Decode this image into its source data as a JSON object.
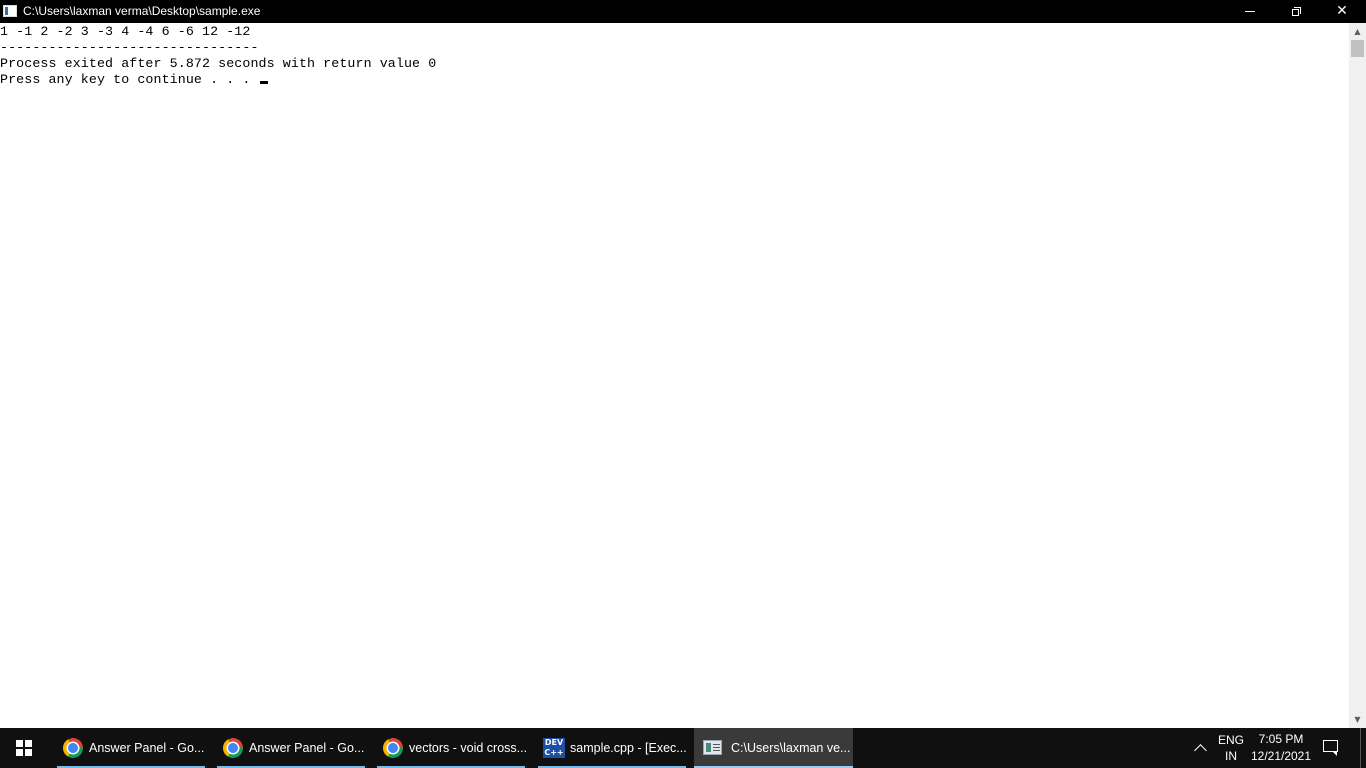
{
  "window": {
    "title": "C:\\Users\\laxman verma\\Desktop\\sample.exe",
    "controls": {
      "minimize": "minimize",
      "maximize": "restore",
      "close": "close"
    }
  },
  "console": {
    "lines": [
      "1 -1 2 -2 3 -3 4 -4 6 -6 12 -12",
      "--------------------------------",
      "Process exited after 5.872 seconds with return value 0",
      "Press any key to continue . . . "
    ]
  },
  "taskbar": {
    "items": [
      {
        "label": "Answer Panel - Go...",
        "icon": "chrome-icon",
        "active": false
      },
      {
        "label": "Answer Panel - Go...",
        "icon": "chrome-icon",
        "active": false
      },
      {
        "label": "vectors - void cross...",
        "icon": "chrome-icon",
        "active": false
      },
      {
        "label": "sample.cpp - [Exec...",
        "icon": "devcpp-icon",
        "active": false,
        "icon_text": "DEV C++"
      },
      {
        "label": "C:\\Users\\laxman ve...",
        "icon": "console-icon",
        "active": true
      }
    ],
    "tray": {
      "lang_top": "ENG",
      "lang_bottom": "IN",
      "time": "7:05 PM",
      "date": "12/21/2021"
    }
  },
  "colors": {
    "titlebar": "#000000",
    "taskbar": "#101010",
    "active_indicator": "#99ccf5"
  }
}
